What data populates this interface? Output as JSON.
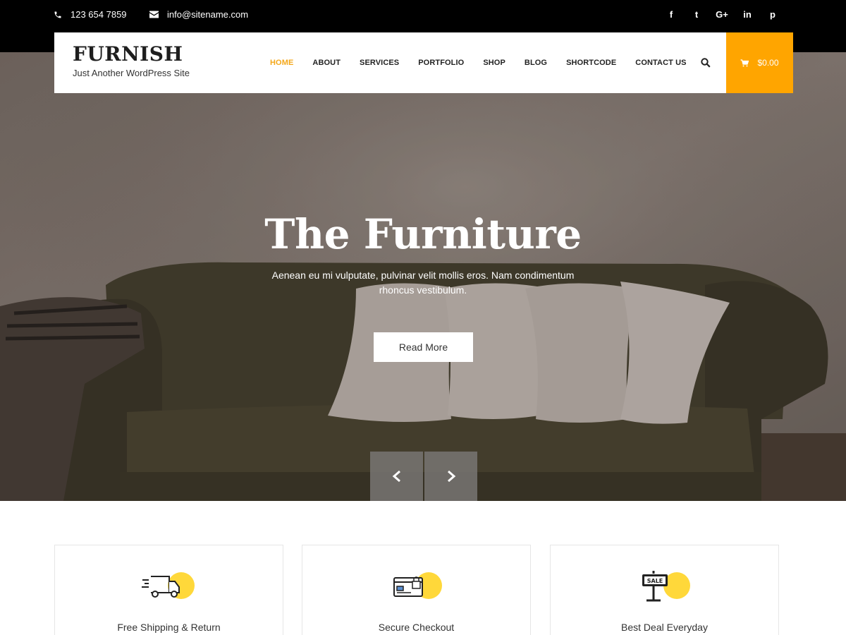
{
  "topbar": {
    "phone": "123 654 7859",
    "email": "info@sitename.com",
    "social": [
      {
        "icon": "facebook-icon",
        "glyph": "f"
      },
      {
        "icon": "twitter-icon",
        "glyph": "t"
      },
      {
        "icon": "google-plus-icon",
        "glyph": "G+"
      },
      {
        "icon": "linkedin-icon",
        "glyph": "in"
      },
      {
        "icon": "pinterest-icon",
        "glyph": "p"
      }
    ]
  },
  "header": {
    "site_title": "FURNISH",
    "tagline": "Just Another WordPress Site",
    "nav": [
      "HOME",
      "ABOUT",
      "SERVICES",
      "PORTFOLIO",
      "SHOP",
      "BLOG",
      "SHORTCODE",
      "CONTACT US"
    ],
    "active_nav": "HOME",
    "cart_total": "$0.00"
  },
  "hero": {
    "title": "The Furniture",
    "description": "Aenean eu mi vulputate, pulvinar velit mollis eros. Nam condimentum rhoncus vestibulum.",
    "button_label": "Read More"
  },
  "features": [
    {
      "title": "Free Shipping & Return",
      "icon": "delivery-truck-icon"
    },
    {
      "title": "Secure Checkout",
      "icon": "secure-card-icon"
    },
    {
      "title": "Best Deal Everyday",
      "icon": "sale-sign-icon"
    }
  ],
  "colors": {
    "accent": "#ffa500",
    "nav_active": "#f4a81b",
    "feature_circle": "#ffd83a",
    "topbar_bg": "#000000"
  }
}
